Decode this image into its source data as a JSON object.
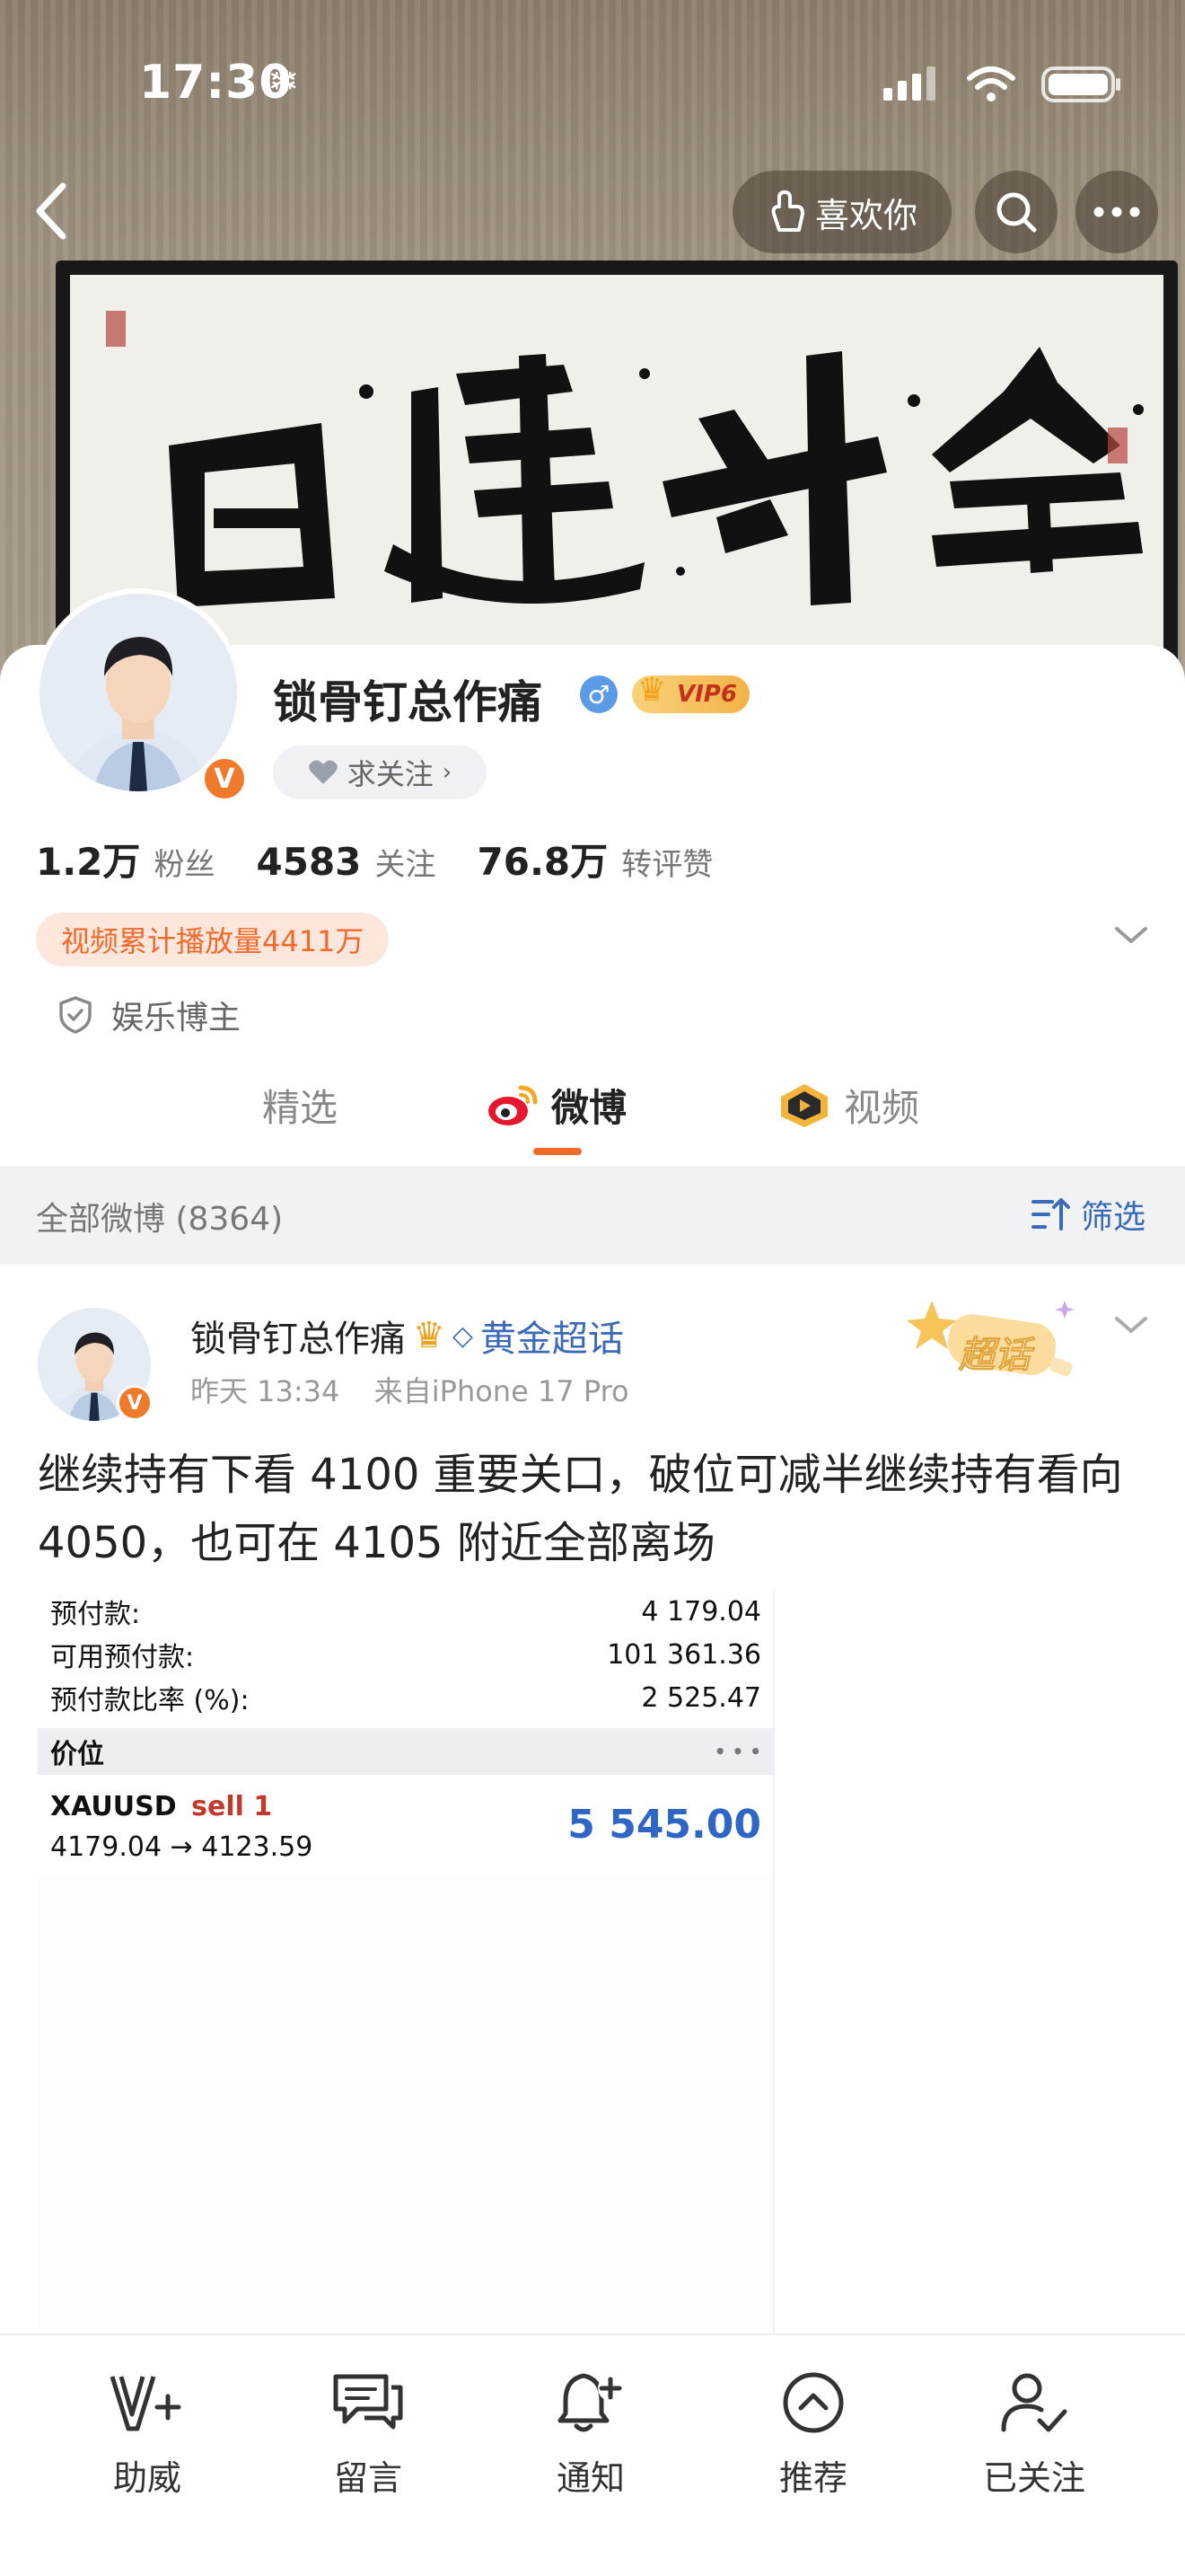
{
  "status_bar": {
    "time": "17:30"
  },
  "header": {
    "like_label": "喜欢你"
  },
  "cover": {
    "calligraphy_text": "日进斗金"
  },
  "profile": {
    "name": "锁骨钉总作痛",
    "vip_label": "VIP6",
    "follow_ask_label": "求关注",
    "stats": [
      {
        "value": "1.2万",
        "label": "粉丝"
      },
      {
        "value": "4583",
        "label": "关注"
      },
      {
        "value": "76.8万",
        "label": "转评赞"
      }
    ],
    "play_count_badge": "视频累计播放量4411万",
    "role": "娱乐博主"
  },
  "tabs": [
    {
      "label": "精选"
    },
    {
      "label": "微博"
    },
    {
      "label": "视频"
    }
  ],
  "filter_bar": {
    "count_label": "全部微博 (8364)",
    "filter_label": "筛选"
  },
  "post": {
    "author": "锁骨钉总作痛",
    "topic": "黄金超话",
    "time": "昨天 13:34",
    "source": "来自iPhone 17 Pro",
    "chaohua_label": "超话",
    "text": "继续持有下看 4100 重要关口，破位可减半继续持有看向 4050，也可在 4105 附近全部离场",
    "trade": {
      "rows": [
        {
          "key": "预付款:",
          "value": "4 179.04"
        },
        {
          "key": "可用预付款:",
          "value": "101 361.36"
        },
        {
          "key": "预付款比率 (%):",
          "value": "2 525.47"
        }
      ],
      "section_title": "价位",
      "section_more": "• • •",
      "symbol": "XAUUSD",
      "side": "sell 1",
      "route": "4179.04 → 4123.59",
      "profit": "5 545.00"
    }
  },
  "bottom_bar": [
    {
      "label": "助威",
      "icon": "cheer-icon"
    },
    {
      "label": "留言",
      "icon": "message-icon"
    },
    {
      "label": "通知",
      "icon": "bell-plus-icon"
    },
    {
      "label": "推荐",
      "icon": "recommend-icon"
    },
    {
      "label": "已关注",
      "icon": "followed-icon"
    }
  ]
}
